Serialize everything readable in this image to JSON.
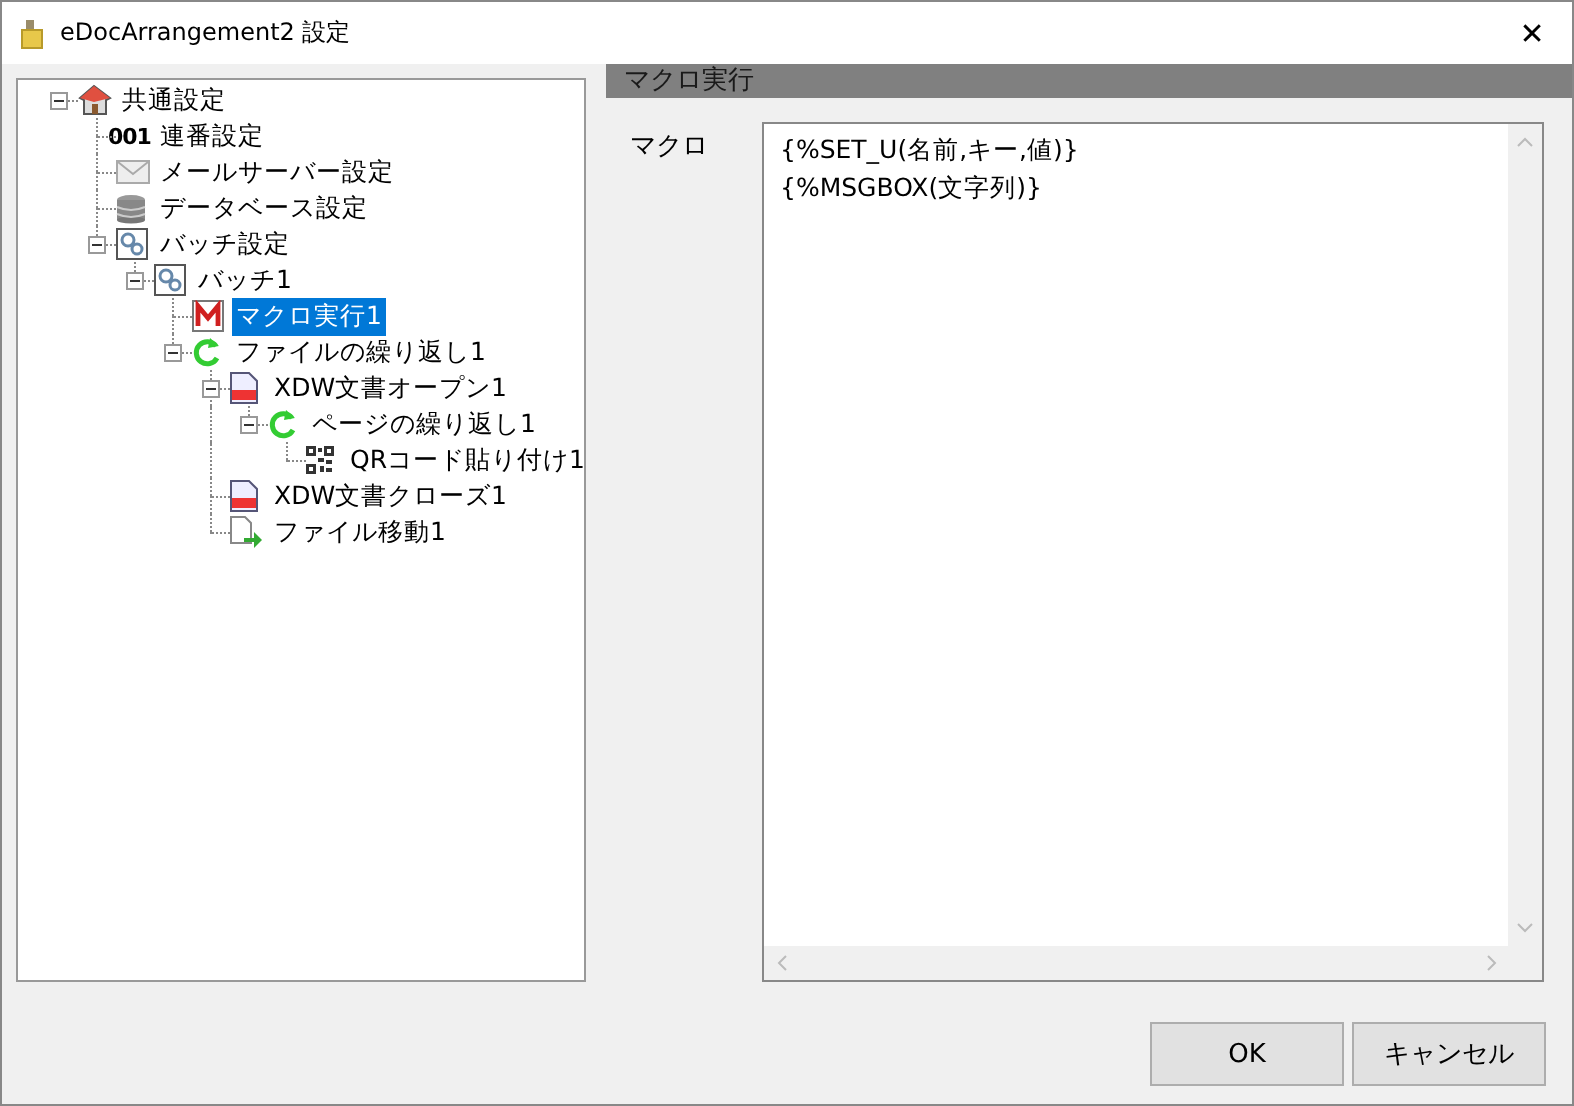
{
  "window": {
    "title": "eDocArrangement2 設定",
    "close": "✕"
  },
  "tree": [
    {
      "label": "共通設定",
      "kind": "home",
      "expanded": true,
      "selected": false,
      "children": [
        {
          "label": "連番設定",
          "kind": "counter",
          "icon_text": "001",
          "selected": false
        },
        {
          "label": "メールサーバー設定",
          "kind": "mail",
          "selected": false
        },
        {
          "label": "データベース設定",
          "kind": "database",
          "selected": false
        },
        {
          "label": "バッチ設定",
          "kind": "batch",
          "expanded": true,
          "selected": false,
          "children": [
            {
              "label": "バッチ1",
              "kind": "batch",
              "expanded": true,
              "selected": false,
              "children": [
                {
                  "label": "マクロ実行1",
                  "kind": "macro",
                  "selected": true
                },
                {
                  "label": "ファイルの繰り返し1",
                  "kind": "loop",
                  "expanded": true,
                  "selected": false,
                  "children": [
                    {
                      "label": "XDW文書オープン1",
                      "kind": "xdw",
                      "expanded": true,
                      "selected": false,
                      "children": [
                        {
                          "label": "ページの繰り返し1",
                          "kind": "loop",
                          "expanded": true,
                          "selected": false,
                          "children": [
                            {
                              "label": "QRコード貼り付け1",
                              "kind": "qr",
                              "selected": false
                            }
                          ]
                        }
                      ]
                    },
                    {
                      "label": "XDW文書クローズ1",
                      "kind": "xdw",
                      "selected": false
                    },
                    {
                      "label": "ファイル移動1",
                      "kind": "move",
                      "selected": false
                    }
                  ]
                }
              ]
            }
          ]
        }
      ]
    }
  ],
  "panel": {
    "header": "マクロ実行",
    "field_label": "マクロ",
    "lines": [
      "{%SET_U(名前,キー,値)}",
      "{%MSGBOX(文字列)}"
    ]
  },
  "buttons": [
    {
      "label": "OK"
    },
    {
      "label": "キャンセル"
    }
  ]
}
